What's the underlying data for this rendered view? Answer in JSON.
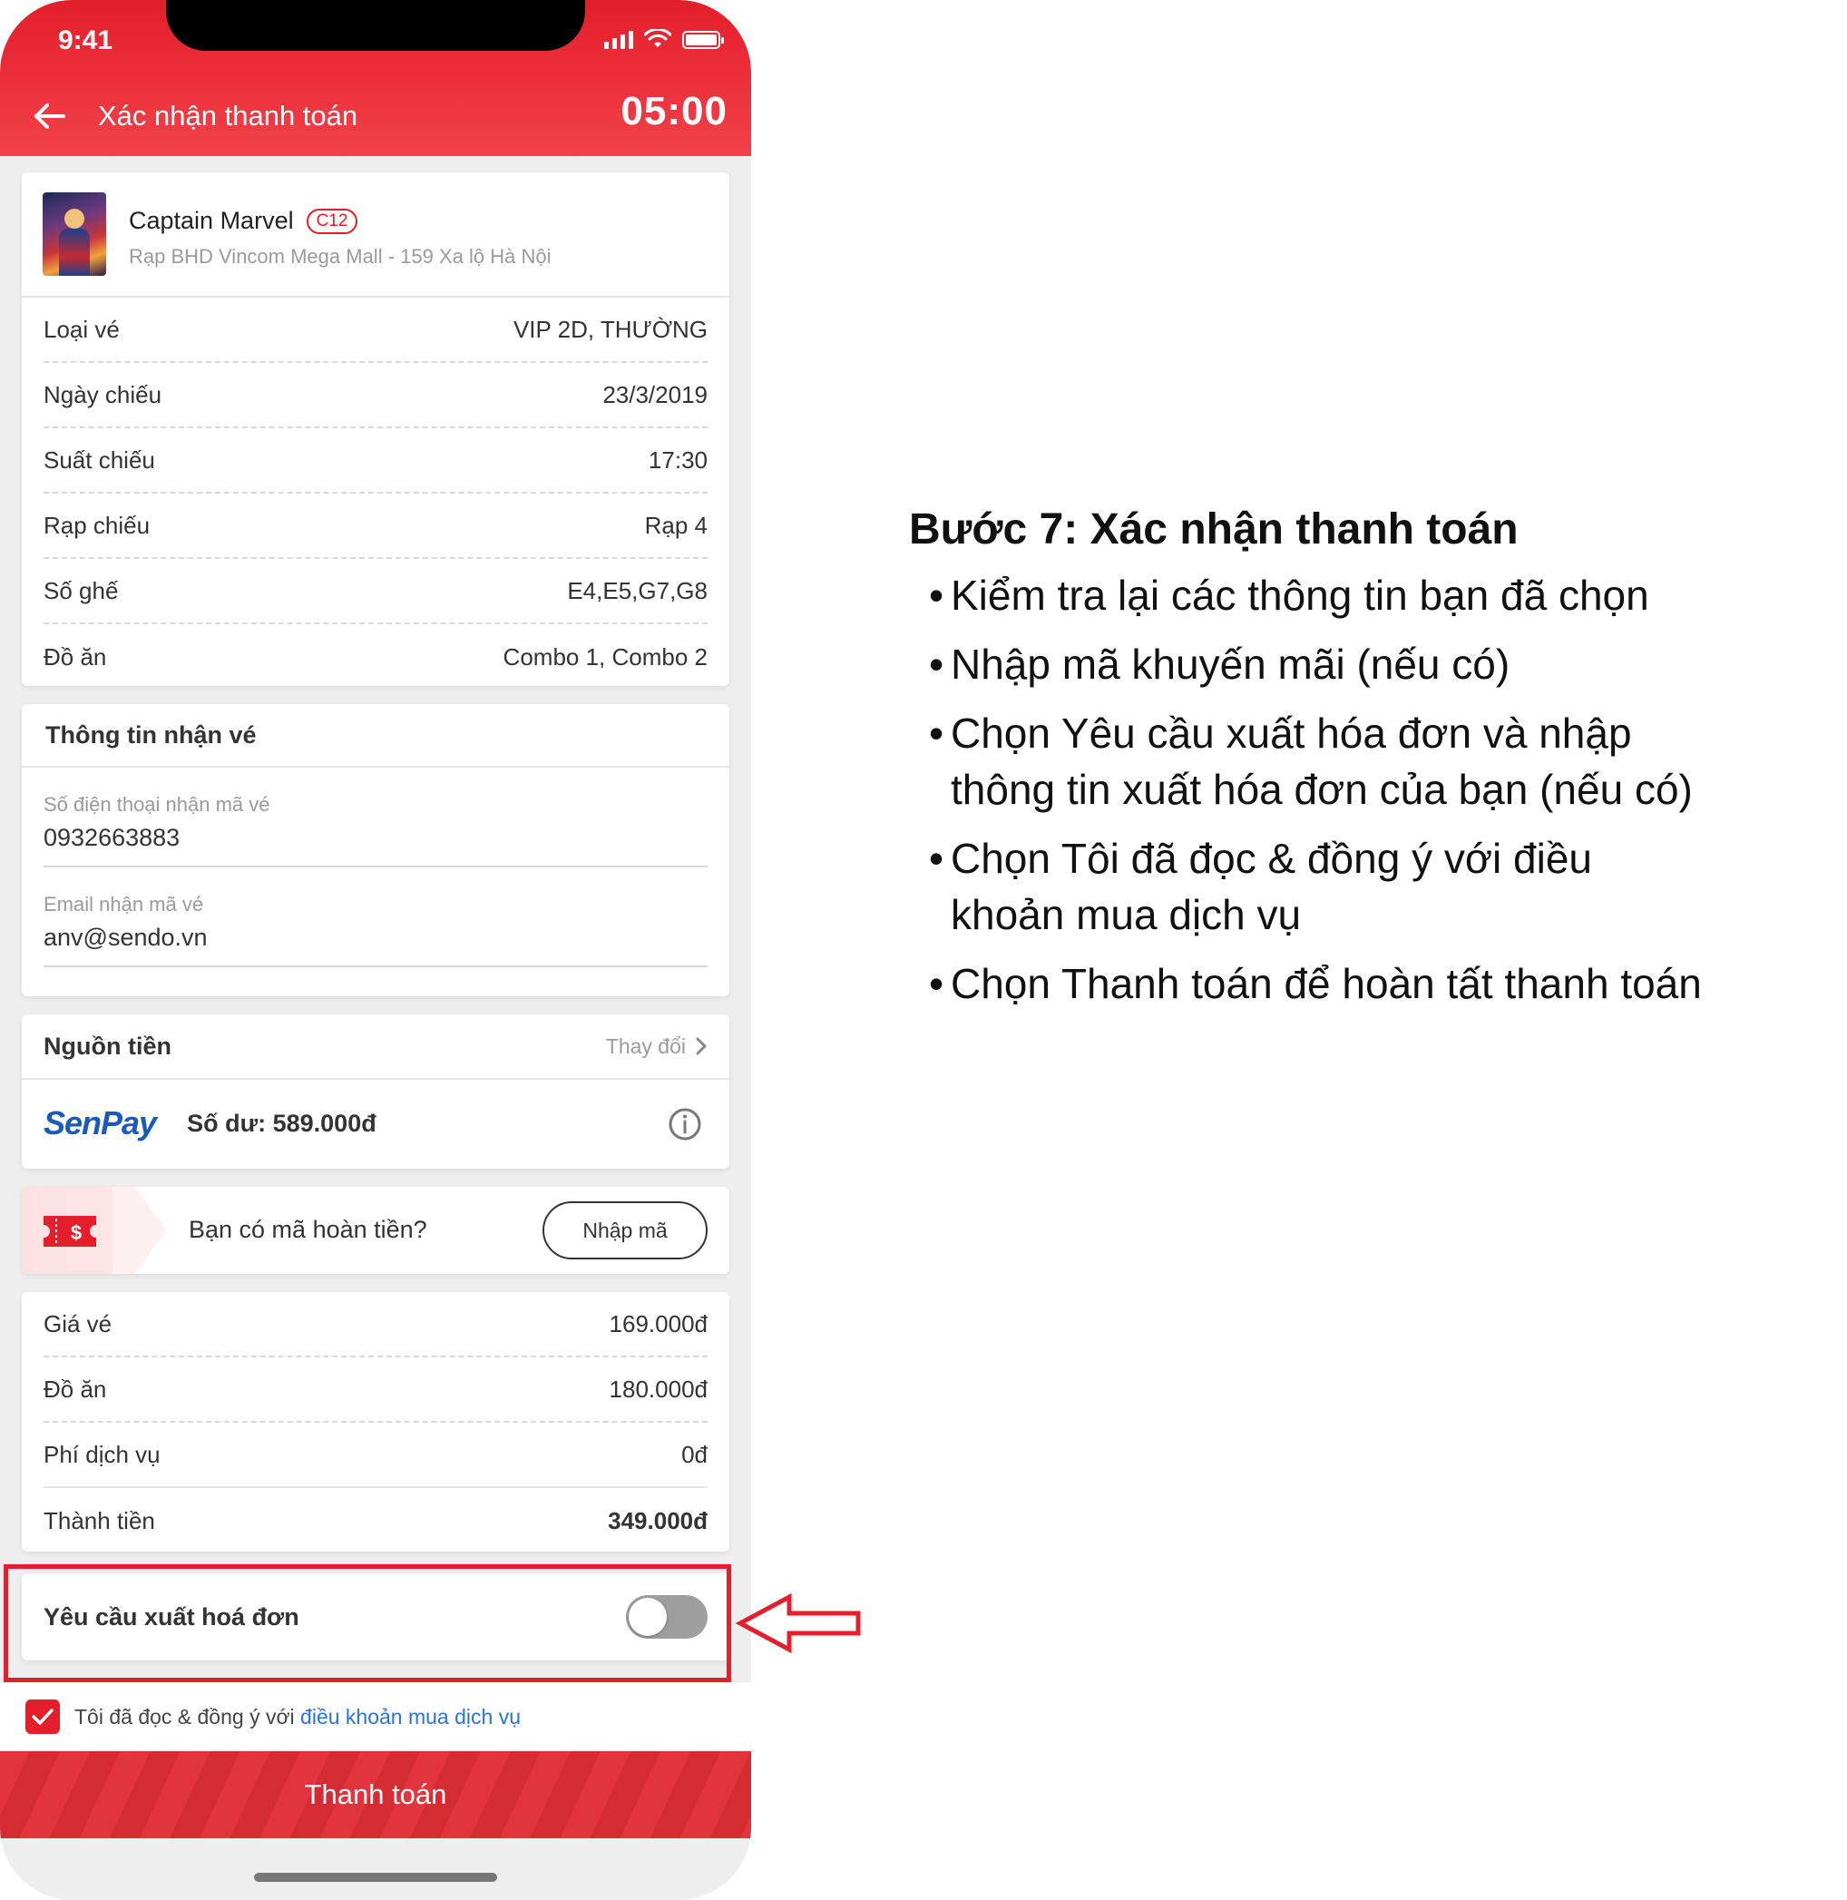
{
  "status_bar": {
    "time": "9:41"
  },
  "header": {
    "title": "Xác nhận thanh toán",
    "countdown": "05:00"
  },
  "movie": {
    "title": "Captain Marvel",
    "rating": "C12",
    "cinema": "Rạp BHD Vincom Mega Mall - 159 Xa lộ Hà Nội"
  },
  "details": [
    {
      "label": "Loại vé",
      "value": "VIP 2D, THƯỜNG"
    },
    {
      "label": "Ngày chiếu",
      "value": "23/3/2019"
    },
    {
      "label": "Suất chiếu",
      "value": "17:30"
    },
    {
      "label": "Rạp chiếu",
      "value": "Rạp 4"
    },
    {
      "label": "Số ghế",
      "value": "E4,E5,G7,G8"
    },
    {
      "label": "Đồ ăn",
      "value": "Combo 1, Combo 2"
    }
  ],
  "receive": {
    "title": "Thông tin nhận vé",
    "phone_label": "Số điện thoại nhận mã vé",
    "phone_value": "0932663883",
    "email_label": "Email nhận mã vé",
    "email_value": "anv@sendo.vn"
  },
  "source": {
    "title": "Nguồn tiền",
    "change": "Thay đổi",
    "logo": "SenPay",
    "balance": "Số dư: 589.000đ"
  },
  "voucher": {
    "question": "Bạn có mã hoàn tiền?",
    "button": "Nhập mã"
  },
  "summary": [
    {
      "label": "Giá vé",
      "value": "169.000đ"
    },
    {
      "label": "Đồ ăn",
      "value": "180.000đ"
    },
    {
      "label": "Phí dịch vụ",
      "value": "0đ"
    },
    {
      "label": "Thành tiền",
      "value": "349.000đ"
    }
  ],
  "invoice": {
    "label": "Yêu cầu xuất hoá đơn",
    "enabled": false
  },
  "terms": {
    "text": "Tôi đã đọc & đồng ý với ",
    "link": "điều khoản mua dịch vụ",
    "checked": true
  },
  "pay_button": "Thanh toán",
  "colors": {
    "brand": "#e41e2b",
    "link": "#2a74d6",
    "senpay": "#1a5bb8"
  },
  "instructions": {
    "title": "Bước 7: Xác nhận thanh toán",
    "items": [
      " Kiểm tra lại các thông tin bạn đã chọn",
      "Nhập mã khuyến mãi (nếu có)",
      "Chọn Yêu cầu xuất hóa đơn và nhập thông tin xuất hóa đơn của bạn (nếu có)",
      "Chọn Tôi đã đọc & đồng ý với điều khoản mua dịch vụ",
      "Chọn Thanh toán để hoàn tất thanh toán"
    ]
  }
}
